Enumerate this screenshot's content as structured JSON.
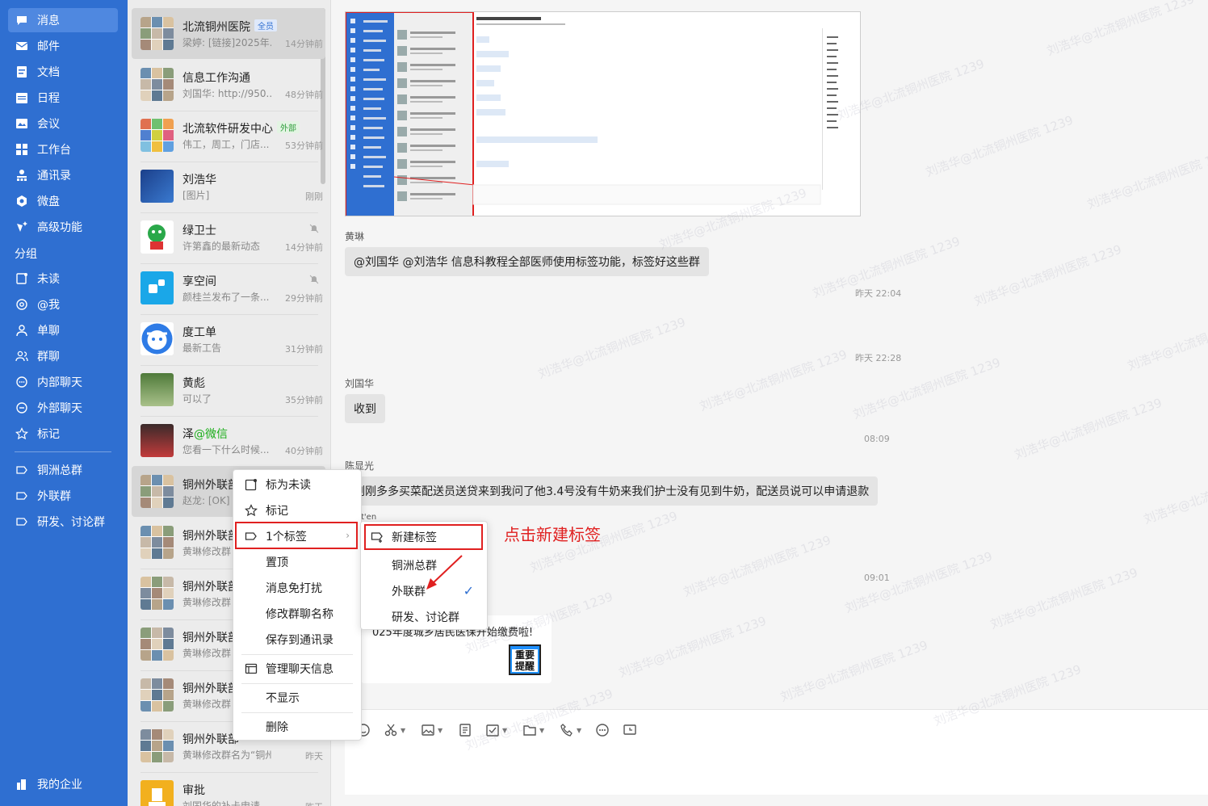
{
  "nav": {
    "items": [
      {
        "label": "消息",
        "icon": "chat-bubble-icon",
        "active": true
      },
      {
        "label": "邮件",
        "icon": "mail-icon"
      },
      {
        "label": "文档",
        "icon": "document-icon"
      },
      {
        "label": "日程",
        "icon": "calendar-icon"
      },
      {
        "label": "会议",
        "icon": "meeting-icon"
      },
      {
        "label": "工作台",
        "icon": "grid-icon"
      },
      {
        "label": "通讯录",
        "icon": "contacts-icon"
      },
      {
        "label": "微盘",
        "icon": "drive-icon"
      },
      {
        "label": "高级功能",
        "icon": "sparkle-icon"
      }
    ],
    "group_title": "分组",
    "groups": [
      {
        "label": "未读",
        "icon": "unread-icon"
      },
      {
        "label": "@我",
        "icon": "at-icon"
      },
      {
        "label": "单聊",
        "icon": "person-icon"
      },
      {
        "label": "群聊",
        "icon": "group-icon"
      },
      {
        "label": "内部聊天",
        "icon": "internal-chat-icon"
      },
      {
        "label": "外部聊天",
        "icon": "external-chat-icon"
      },
      {
        "label": "标记",
        "icon": "star-icon"
      }
    ],
    "tags": [
      {
        "label": "铜洲总群",
        "icon": "tag-icon"
      },
      {
        "label": "外联群",
        "icon": "tag-icon"
      },
      {
        "label": "研发、讨论群",
        "icon": "tag-icon"
      }
    ],
    "footer": "我的企业"
  },
  "chats": [
    {
      "name": "北流铜州医院",
      "tag": "全员",
      "tagType": "blue",
      "preview": "梁婷: [链接]2025年...",
      "time": "14分钟前",
      "selected": true,
      "avatar": "grid"
    },
    {
      "name": "信息工作沟通",
      "preview": "刘国华: http://950...",
      "time": "48分钟前",
      "avatar": "grid"
    },
    {
      "name": "北流软件研发中心",
      "tag": "外部",
      "tagType": "green",
      "preview": "伟工，周工，门店...",
      "time": "53分钟前",
      "avatar": "grid-color"
    },
    {
      "name": "刘浩华",
      "preview": "[图片]",
      "time": "刚刚",
      "avatar": "blue-photo"
    },
    {
      "name": "绿卫士",
      "preview": "许第鑫的最新动态",
      "time": "14分钟前",
      "muted": true,
      "avatar": "green-mascot"
    },
    {
      "name": "享空间",
      "preview": "颜桂兰发布了一条...",
      "time": "29分钟前",
      "muted": true,
      "avatar": "cyan-logo"
    },
    {
      "name": "度工单",
      "preview": "最新工告",
      "time": "31分钟前",
      "avatar": "blue-face"
    },
    {
      "name": "黄彪",
      "preview": "可以了",
      "time": "35分钟前",
      "avatar": "photo-green"
    },
    {
      "name": "泽",
      "wechat": "@微信",
      "preview": "您看一下什么时候...",
      "time": "40分钟前",
      "avatar": "photo-red"
    },
    {
      "name": "铜州外联部",
      "preview": "赵龙: [OK]",
      "time": "",
      "avatar": "grid",
      "hovered": true
    },
    {
      "name": "铜州外联部",
      "preview": "黄琳修改群",
      "time": "",
      "avatar": "grid"
    },
    {
      "name": "铜州外联部",
      "preview": "黄琳修改群",
      "time": "",
      "avatar": "grid"
    },
    {
      "name": "铜州外联部",
      "preview": "黄琳修改群",
      "time": "",
      "avatar": "grid"
    },
    {
      "name": "铜州外联部",
      "preview": "黄琳修改群",
      "time": "",
      "avatar": "grid"
    },
    {
      "name": "铜州外联部",
      "preview": "黄琳修改群名为“铜州...",
      "time": "昨天",
      "avatar": "grid"
    },
    {
      "name": "审批",
      "preview": "刘国华的补卡申请",
      "time": "昨天",
      "avatar": "yellow-approve"
    }
  ],
  "messages": {
    "sender1": "黄琳",
    "msg1": "@刘国华  @刘浩华  信息科教程全部医师使用标签功能，标签好这些群",
    "time1": "昨天 22:04",
    "time2": "昨天 22:28",
    "sender2": "刘国华",
    "msg2": "收到",
    "time3": "08:09",
    "sender3": "陈显光",
    "msg3": "刚刚多多买菜配送员送贷来到我问了他3.4号没有牛奶来我们护士没有见到牛奶，配送员说可以申请退款",
    "sender4_fragment": "t'en",
    "time4": "09:01",
    "card_text": "025年度城乡居民医保开始缴费啦!",
    "card_badge": "重要提醒"
  },
  "context_menu": {
    "items": [
      {
        "label": "标为未读",
        "icon": "mark-unread-icon"
      },
      {
        "label": "标记",
        "icon": "star-icon"
      },
      {
        "label": "1个标签",
        "icon": "tag-icon",
        "submenu": true
      },
      {
        "label": "置顶"
      },
      {
        "label": "消息免打扰"
      },
      {
        "label": "修改群聊名称"
      },
      {
        "label": "保存到通讯录"
      },
      {
        "label": "管理聊天信息",
        "icon": "manage-icon"
      },
      {
        "label": "不显示"
      },
      {
        "label": "删除"
      }
    ]
  },
  "tag_submenu": {
    "items": [
      {
        "label": "新建标签",
        "icon": "new-tag-icon"
      },
      {
        "label": "铜洲总群"
      },
      {
        "label": "外联群",
        "checked": true
      },
      {
        "label": "研发、讨论群"
      }
    ]
  },
  "annotation": "点击新建标签",
  "watermark": "刘浩华@北流铜州医院 1239",
  "colors": {
    "nav_bg": "#2f6fd1",
    "accent": "#2f6fd1",
    "annotation_red": "#e02020"
  }
}
